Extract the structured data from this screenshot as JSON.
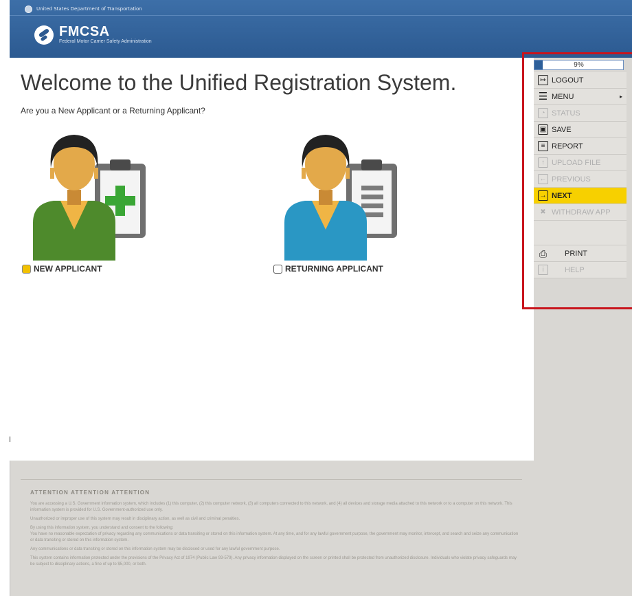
{
  "header": {
    "dot_text": "United States Department of Transportation",
    "logo_title": "FMCSA",
    "logo_subtitle": "Federal Motor Carrier Safety Administration"
  },
  "main": {
    "title": "Welcome to the Unified Registration System.",
    "subtitle": "Are you a New Applicant or a Returning Applicant?",
    "options": [
      {
        "label": "NEW APPLICANT",
        "checked": true
      },
      {
        "label": "RETURNING APPLICANT",
        "checked": false
      }
    ]
  },
  "sidebar": {
    "progress_label": "9%",
    "progress_fraction": 0.09,
    "items": [
      {
        "label": "LOGOUT",
        "icon": "logout-icon",
        "disabled": false
      },
      {
        "label": "MENU",
        "icon": "hamburger-icon",
        "disabled": false
      },
      {
        "label": "STATUS",
        "icon": "status-icon",
        "disabled": true
      },
      {
        "label": "SAVE",
        "icon": "save-icon",
        "disabled": false
      },
      {
        "label": "REPORT",
        "icon": "report-icon",
        "disabled": false
      },
      {
        "label": "UPLOAD FILE",
        "icon": "upload-icon",
        "disabled": true
      },
      {
        "label": "PREVIOUS",
        "icon": "previous-icon",
        "disabled": true
      },
      {
        "label": "NEXT",
        "icon": "next-icon",
        "disabled": false
      },
      {
        "label": "WITHDRAW APP",
        "icon": "withdraw-icon",
        "disabled": true
      },
      {
        "label": "PRINT",
        "icon": "print-icon",
        "disabled": false
      },
      {
        "label": "HELP",
        "icon": "help-icon",
        "disabled": true
      }
    ]
  },
  "footer": {
    "heading": "ATTENTION ATTENTION ATTENTION",
    "paragraphs": [
      "You are accessing a U.S. Government information system, which includes (1) this computer, (2) this computer network, (3) all computers connected to this network, and (4) all devices and storage media attached to this network or to a computer on this network. This information system is provided for U.S. Government-authorized use only.",
      "Unauthorized or improper use of this system may result in disciplinary action, as well as civil and criminal penalties.",
      "By using this information system, you understand and consent to the following:",
      "You have no reasonable expectation of privacy regarding any communications or data transiting or stored on this information system. At any time, and for any lawful government purpose, the government may monitor, intercept, and search and seize any communication or data transiting or stored on this information system.",
      "Any communications or data transiting or stored on this information system may be disclosed or used for any lawful government purpose.",
      "This system contains information protected under the provisions of the Privacy Act of 1974 (Public Law 93-579). Any privacy information displayed on the screen or printed shall be protected from unauthorized disclosure. Individuals who violate privacy safeguards may be subject to disciplinary actions, a fine of up to $5,000, or both."
    ]
  },
  "colors": {
    "header_blue": "#2c5a91",
    "next_highlight": "#f7d000",
    "highlight_box": "#c8141c"
  }
}
